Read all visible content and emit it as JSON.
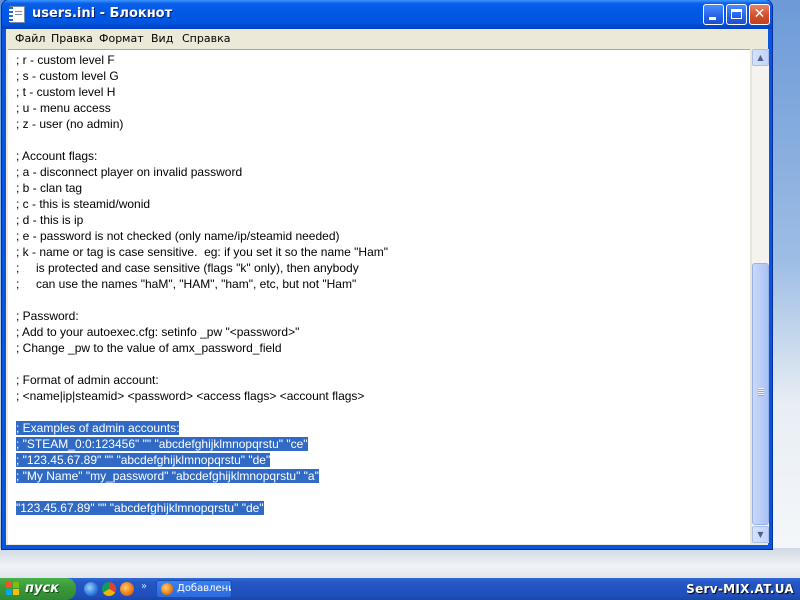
{
  "window": {
    "title": "users.ini - Блокнот",
    "minimize_label": "",
    "maximize_label": "",
    "close_label": "✕"
  },
  "menu": {
    "items": [
      {
        "label": "Файл"
      },
      {
        "label": "Правка"
      },
      {
        "label": "Формат"
      },
      {
        "label": "Вид"
      },
      {
        "label": "Справка"
      }
    ]
  },
  "editor": {
    "lines": [
      {
        "text": "; r - custom level F",
        "selected": false
      },
      {
        "text": "; s - custom level G",
        "selected": false
      },
      {
        "text": "; t - custom level H",
        "selected": false
      },
      {
        "text": "; u - menu access",
        "selected": false
      },
      {
        "text": "; z - user (no admin)",
        "selected": false
      },
      {
        "text": "",
        "selected": false
      },
      {
        "text": "; Account flags:",
        "selected": false
      },
      {
        "text": "; a - disconnect player on invalid password",
        "selected": false
      },
      {
        "text": "; b - clan tag",
        "selected": false
      },
      {
        "text": "; c - this is steamid/wonid",
        "selected": false
      },
      {
        "text": "; d - this is ip",
        "selected": false
      },
      {
        "text": "; e - password is not checked (only name/ip/steamid needed)",
        "selected": false
      },
      {
        "text": "; k - name or tag is case sensitive.  eg: if you set it so the name \"Ham\"",
        "selected": false
      },
      {
        "text": ";     is protected and case sensitive (flags \"k\" only), then anybody",
        "selected": false
      },
      {
        "text": ";     can use the names \"haM\", \"HAM\", \"ham\", etc, but not \"Ham\"",
        "selected": false
      },
      {
        "text": "",
        "selected": false
      },
      {
        "text": "; Password:",
        "selected": false
      },
      {
        "text": "; Add to your autoexec.cfg: setinfo _pw \"<password>\"",
        "selected": false
      },
      {
        "text": "; Change _pw to the value of amx_password_field",
        "selected": false
      },
      {
        "text": "",
        "selected": false
      },
      {
        "text": "; Format of admin account:",
        "selected": false
      },
      {
        "text": "; <name|ip|steamid> <password> <access flags> <account flags>",
        "selected": false
      },
      {
        "text": "",
        "selected": false
      },
      {
        "text": "; Examples of admin accounts:",
        "selected": true
      },
      {
        "text": "; \"STEAM_0:0:123456\" \"\" \"abcdefghijklmnopqrstu\" \"ce\"",
        "selected": true
      },
      {
        "text": "; \"123.45.67.89\" \"\" \"abcdefghijklmnopqrstu\" \"de\"",
        "selected": true
      },
      {
        "text": "; \"My Name\" \"my_password\" \"abcdefghijklmnopqrstu\" \"a\"",
        "selected": true
      },
      {
        "text": "",
        "selected": false
      },
      {
        "text": "\"123.45.67.89\" \"\" \"abcdefghijklmnopqrstu\" \"de\"",
        "selected": true
      }
    ]
  },
  "scrollbar": {
    "up_arrow": "▲",
    "down_arrow": "▼",
    "position": 0.9
  },
  "taskbar": {
    "start_label": "пуск",
    "chevron": "»",
    "task_label": "Добавлени",
    "quick_launch": [
      "browser-icon",
      "chrome-icon",
      "firefox-icon"
    ]
  },
  "watermark": "Serv-MIX.AT.UA",
  "colors": {
    "selection": "#316ac5",
    "titlebar": "#0058e6",
    "start": "#3a9a3a"
  }
}
